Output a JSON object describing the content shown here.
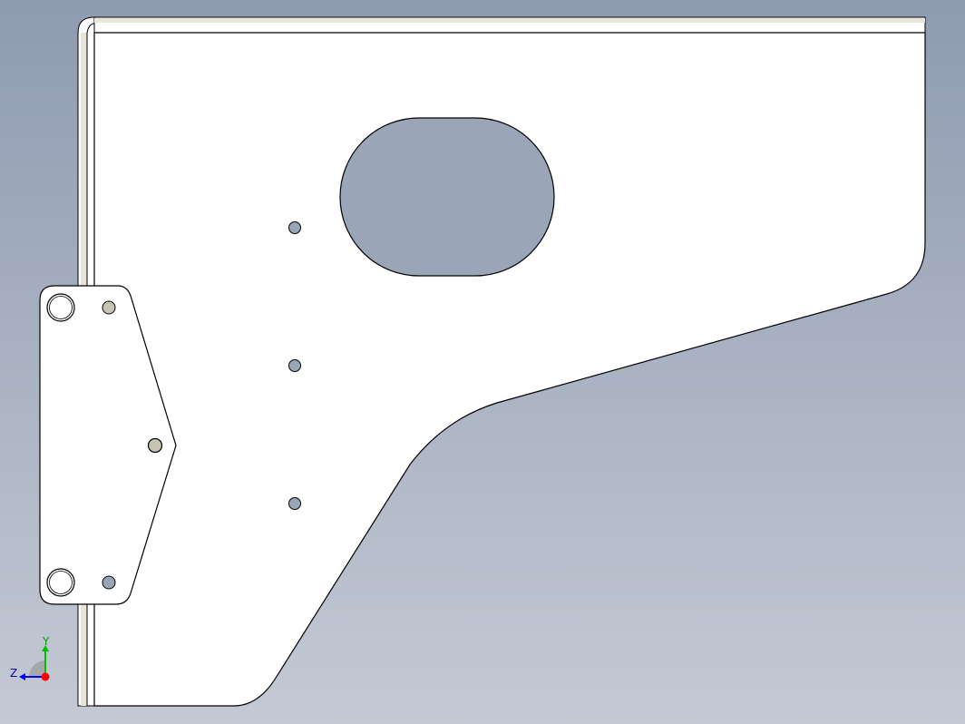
{
  "colors": {
    "bg_top": "#8e9bb0",
    "bg_bottom": "#c4c9d4",
    "part_fill": "#ffffff",
    "edge": "#000000",
    "hole_fill": "#9aa6b8",
    "fastener_fill": "#c8c4b4",
    "axis_x": "#ff0000",
    "axis_y": "#00c000",
    "axis_z": "#0000ff"
  },
  "triad": {
    "y_label": "Y",
    "z_label": "Z",
    "x_color": "red",
    "y_color": "green",
    "z_color": "blue"
  }
}
